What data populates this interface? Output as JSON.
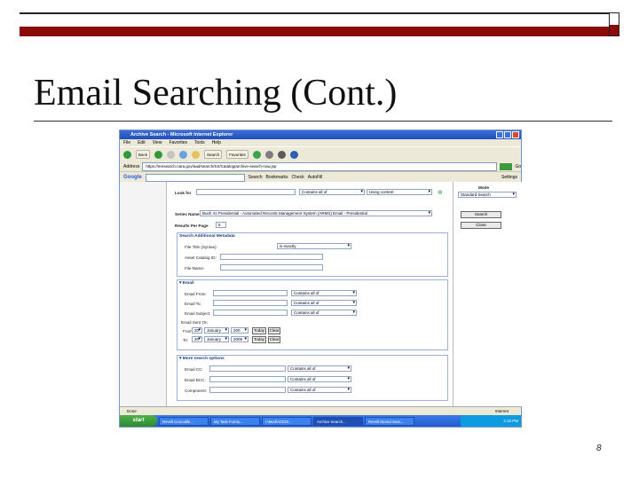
{
  "slide": {
    "title": "Email Searching (Cont.)",
    "page_number": "8"
  },
  "browser": {
    "window_title": "Archive Search - Microsoft Internet Explorer",
    "menu": [
      "File",
      "Edit",
      "View",
      "Favorites",
      "Tools",
      "Help"
    ],
    "toolbar": {
      "back": "Back",
      "search": "Search",
      "favorites": "Favorites"
    },
    "address_label": "Address",
    "address": "https://eresearch.nara.gov/aad/search/SS/Catalog/archive-search-now.jsp",
    "go": "Go",
    "google": {
      "logo": "Google",
      "search": "Search",
      "bookmarks": "Bookmarks",
      "check": "Check",
      "autofill": "AutoFill",
      "settings": "Settings"
    }
  },
  "form": {
    "look_for_label": "Look for",
    "look_for_value": "",
    "look_for_mode": "Contains all of",
    "look_for_scope": "Using content",
    "series_label": "Series Name",
    "series_value": "Bush 41 Presidential - Automated Records Management System (ARMS) Email - Presidential",
    "results_label": "Results Per Page",
    "results_value": "5",
    "additional_header": "Search Additional Metadata",
    "file_system_label": "File Title (Syntax):",
    "file_system_mode": "is exactly",
    "asset_label": "Asset Catalog ID:",
    "file_name_label": "File Name:",
    "email_header": "Email",
    "email_from_label": "Email From:",
    "email_to_label": "Email To:",
    "email_subject_label": "Email Subject:",
    "contains_all": "Contains all of",
    "sent_on_label": "Email Sent On",
    "from_label": "From:",
    "to_label": "To:",
    "from_date": {
      "day": "20",
      "month": "January",
      "year": "200"
    },
    "to_date": {
      "day": "20",
      "month": "January",
      "year": "2009"
    },
    "today_btn": "Today",
    "clear_btn": "Clear",
    "more_header": "More search options",
    "email_cc_label": "Email CC:",
    "email_bcc_label": "Email BCC:",
    "component_label": "Component:"
  },
  "right_panel": {
    "mode_label": "Mode",
    "mode_value": "Standard Search",
    "search_btn": "Search",
    "close_btn": "Close"
  },
  "status": {
    "left": "Done",
    "right": "Internet"
  },
  "taskbar": {
    "start": "start",
    "items": [
      "Revell Crocodile...",
      "My Task Forms...",
      "I:\\Mod\\AIS\\20...",
      "Archive Search...",
      "Revell Stored Sear..."
    ],
    "active_index": 3,
    "clock": "2:16 PM"
  }
}
